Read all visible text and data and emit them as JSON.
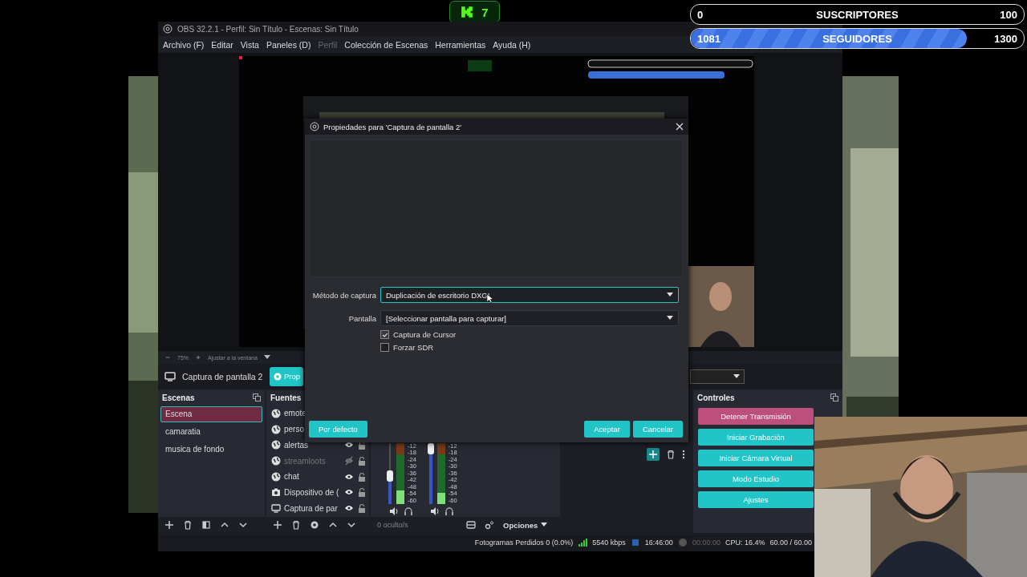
{
  "badge": {
    "count": "7"
  },
  "goals": [
    {
      "start": "0",
      "label": "SUSCRIPTORES",
      "end": "100",
      "level": 0
    },
    {
      "start": "1081",
      "label": "SEGUIDORES",
      "end": "1300",
      "level": 0.83
    }
  ],
  "window": {
    "title": "OBS 32.2.1 - Perfil: Sin Título - Escenas: Sin Título"
  },
  "menu": [
    {
      "label": "Archivo (F)",
      "disabled": false
    },
    {
      "label": "Editar",
      "disabled": false
    },
    {
      "label": "Vista",
      "disabled": false
    },
    {
      "label": "Paneles (D)",
      "disabled": false
    },
    {
      "label": "Perfil",
      "disabled": true
    },
    {
      "label": "Colección de Escenas",
      "disabled": false
    },
    {
      "label": "Herramientas",
      "disabled": false
    },
    {
      "label": "Ayuda (H)",
      "disabled": false
    }
  ],
  "preview": {
    "zoom": "75%",
    "fit": "Ajustar a la ventana"
  },
  "source_toolbar": {
    "source": "Captura de pantalla 2",
    "properties_button": "Prop"
  },
  "scenes": {
    "title": "Escenas",
    "items": [
      {
        "name": "Escena",
        "selected": true
      },
      {
        "name": "camaratia",
        "selected": false
      },
      {
        "name": "musica de fondo",
        "selected": false
      }
    ]
  },
  "sources": {
    "title": "Fuentes",
    "items": [
      {
        "name": "emote",
        "kind": "browser"
      },
      {
        "name": "perso",
        "kind": "browser"
      },
      {
        "name": "alertas",
        "kind": "browser",
        "visible": true,
        "locked": false
      },
      {
        "name": "streamloots",
        "kind": "browser",
        "visible": false,
        "locked": false
      },
      {
        "name": "chat",
        "kind": "browser",
        "visible": true,
        "locked": false
      },
      {
        "name": "Dispositivo de (",
        "kind": "camera",
        "visible": true,
        "locked": false
      },
      {
        "name": "Captura de par",
        "kind": "display",
        "visible": true,
        "locked": false
      }
    ]
  },
  "mixer": {
    "channels": [
      {
        "fader": {
          "level": 0.45
        },
        "meter": {
          "level": 0.22
        },
        "scale": [
          "-12",
          "-18",
          "-24",
          "-30",
          "-36",
          "-42",
          "-48",
          "-54",
          "-60"
        ]
      },
      {
        "fader": {
          "level": 1
        },
        "meter": {
          "level": 0.18
        },
        "scale": [
          "-12",
          "-18",
          "-24",
          "-30",
          "-36",
          "-42",
          "-48",
          "-54",
          "-60"
        ]
      }
    ],
    "hidden_count": "0 oculto/s",
    "options": "Opciones"
  },
  "controls": {
    "title": "Controles",
    "buttons": [
      {
        "label": "Detener Transmisión",
        "active": true
      },
      {
        "label": "Iniciar Grabación",
        "active": false
      },
      {
        "label": "Iniciar Cámara Virtual",
        "active": false
      },
      {
        "label": "Modo Estudio",
        "active": false
      },
      {
        "label": "Ajustes",
        "active": false
      }
    ]
  },
  "status": {
    "dropped": "Fotogramas Perdidos 0 (0.0%)",
    "bitrate": "5540 kbps",
    "stream_time": "16:46:00",
    "rec_time": "00:00:00",
    "cpu": "CPU: 16.4%",
    "fps": "60.00 / 60.00"
  },
  "dialog": {
    "title": "Propiedades para 'Captura de pantalla 2'",
    "fields": [
      {
        "label": "Método de captura",
        "value": "Duplicación de escritorio DXGI",
        "focused": true
      },
      {
        "label": "Pantalla",
        "value": "[Seleccionar pantalla para capturar]",
        "focused": false
      }
    ],
    "checkboxes": [
      {
        "label": "Captura de Cursor",
        "checked": true
      },
      {
        "label": "Forzar SDR",
        "checked": false
      }
    ],
    "buttons": [
      {
        "label": "Por defecto",
        "kind": "left"
      },
      {
        "label": "Aceptar",
        "kind": "right"
      },
      {
        "label": "Cancelar",
        "kind": "right"
      }
    ]
  }
}
